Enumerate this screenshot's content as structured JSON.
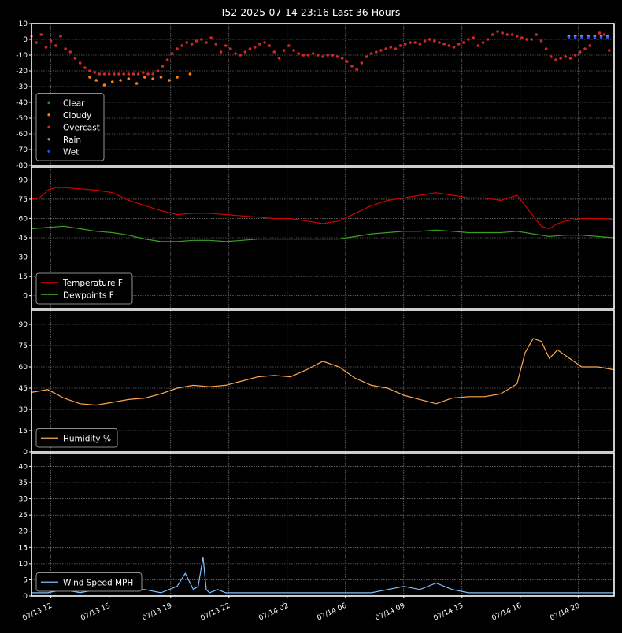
{
  "colors": {
    "background": "#000000",
    "frame": "#ffffff",
    "grid": "#9a9a9a",
    "clear": "#2ca02c",
    "cloudy": "#ff7f0e",
    "overcast": "#d62728",
    "rain": "#9a9a9a",
    "wet": "#1f4fff",
    "temperature": "#d40000",
    "dewpoint": "#3aa020",
    "humidity": "#ffa850",
    "wind": "#7fbfff"
  },
  "chart_data": [
    {
      "type": "scatter",
      "id": "sky",
      "title": "I52 2025-07-14 23:16 Last 36 Hours",
      "ylim": [
        -80,
        10
      ],
      "yticks": [
        10,
        0,
        -10,
        -20,
        -30,
        -40,
        -50,
        -60,
        -70,
        -80
      ],
      "grid": true,
      "legend_position": "lower-left",
      "legend": [
        "Clear",
        "Cloudy",
        "Overcast",
        "Rain",
        "Wet"
      ],
      "series": [
        {
          "name": "Overcast",
          "x": [
            0,
            0.3,
            0.6,
            0.9,
            1.2,
            1.5,
            1.8,
            2.1,
            2.4,
            2.7,
            3.0,
            3.3,
            3.6,
            3.9,
            4.2,
            4.5,
            4.8,
            5.1,
            5.4,
            5.7,
            6.0,
            6.3,
            6.6,
            6.9,
            7.2,
            7.5,
            7.8,
            8.1,
            8.4,
            8.7,
            9.0,
            9.3,
            9.6,
            9.9,
            10.2,
            10.5,
            10.8,
            11.1,
            11.4,
            11.7,
            12.0,
            12.3,
            12.6,
            12.9,
            13.2,
            13.5,
            13.8,
            14.1,
            14.4,
            14.7,
            15.0,
            15.3,
            15.6,
            15.9,
            16.2,
            16.5,
            16.8,
            17.1,
            17.4,
            17.7,
            18.0,
            18.3,
            18.6,
            18.9,
            19.2,
            19.5,
            19.8,
            20.1,
            20.4,
            20.7,
            21.0,
            21.3,
            21.6,
            21.9,
            22.2,
            22.5,
            22.8,
            23.1,
            23.4,
            23.7,
            24.0,
            24.3,
            24.6,
            24.9,
            25.2,
            25.5,
            25.8,
            26.1,
            26.4,
            26.7,
            27.0,
            27.3,
            27.6,
            27.9,
            28.2,
            28.5,
            28.8,
            29.1,
            29.4,
            29.7,
            30.0,
            30.3,
            30.6,
            30.9,
            31.2,
            31.5,
            31.8,
            32.1,
            32.4,
            32.7,
            33.0,
            33.3,
            33.6,
            33.9,
            34.2,
            34.5,
            34.8,
            35.1,
            35.4,
            35.7
          ],
          "y": [
            2,
            -2,
            3,
            -5,
            -1,
            -4,
            2,
            -6,
            -8,
            -12,
            -15,
            -18,
            -20,
            -21,
            -22,
            -22,
            -22,
            -22,
            -22,
            -22,
            -22,
            -22,
            -22,
            -21,
            -22,
            -22,
            -20,
            -17,
            -13,
            -9,
            -6,
            -4,
            -2,
            -3,
            -1,
            0,
            -2,
            1,
            -3,
            -8,
            -4,
            -6,
            -9,
            -10,
            -8,
            -6,
            -5,
            -3,
            -2,
            -4,
            -8,
            -12,
            -7,
            -4,
            -7,
            -9,
            -10,
            -10,
            -9,
            -10,
            -11,
            -10,
            -10,
            -11,
            -12,
            -14,
            -17,
            -19,
            -15,
            -11,
            -9,
            -8,
            -7,
            -6,
            -5,
            -6,
            -4,
            -3,
            -2,
            -2,
            -3,
            -1,
            0,
            -1,
            -2,
            -3,
            -4,
            -5,
            -3,
            -2,
            0,
            1,
            -4,
            -2,
            0,
            3,
            5,
            4,
            3,
            3,
            2,
            1,
            0,
            0,
            3,
            -1,
            -6,
            -11,
            -13,
            -12,
            -11,
            -12,
            -10,
            -8,
            -6,
            -4,
            1,
            4,
            3,
            -7
          ]
        },
        {
          "name": "Cloudy",
          "x": [
            3.6,
            4.0,
            4.5,
            5.0,
            5.5,
            6.0,
            6.5,
            7.0,
            7.5,
            8.0,
            8.5,
            9.0,
            9.8
          ],
          "y": [
            -24,
            -26,
            -29,
            -27,
            -26,
            -25,
            -28,
            -24,
            -25,
            -24,
            -26,
            -24,
            -22
          ]
        },
        {
          "name": "Rain",
          "x": [
            33.2,
            33.6,
            34.0,
            34.4,
            34.8,
            35.2,
            35.6
          ],
          "y": [
            2,
            2,
            2,
            2,
            2,
            2,
            2
          ]
        },
        {
          "name": "Wet",
          "x": [
            33.2,
            33.6,
            34.0,
            34.4,
            34.8,
            35.2,
            35.6
          ],
          "y": [
            1,
            1,
            1,
            1,
            1,
            1,
            1
          ]
        },
        {
          "name": "Clear",
          "x": [],
          "y": []
        }
      ]
    },
    {
      "type": "line",
      "id": "temps",
      "ylim": [
        -10,
        100
      ],
      "yticks": [
        90,
        75,
        60,
        45,
        30,
        15,
        0
      ],
      "grid": true,
      "legend_position": "lower-left",
      "series": [
        {
          "name": "Temperature F",
          "x": [
            0,
            0.5,
            1,
            1.5,
            2,
            3,
            4,
            5,
            6,
            7,
            8,
            9,
            10,
            11,
            12,
            13,
            14,
            15,
            16,
            17,
            18,
            19,
            20,
            21,
            22,
            23,
            24,
            25,
            26,
            27,
            28,
            29,
            30,
            31,
            31.5,
            32,
            32.5,
            33,
            33.5,
            34,
            34.5,
            35,
            35.5,
            36
          ],
          "y": [
            75,
            76,
            82,
            84,
            84,
            83,
            82,
            80,
            74,
            70,
            66,
            63,
            64,
            64,
            63,
            62,
            61,
            60,
            60,
            58,
            56,
            58,
            64,
            70,
            74,
            76,
            78,
            80,
            78,
            76,
            76,
            74,
            78,
            62,
            54,
            52,
            56,
            58,
            59,
            60,
            60,
            60,
            60,
            59
          ]
        },
        {
          "name": "Dewpoints F",
          "x": [
            0,
            1,
            2,
            3,
            4,
            5,
            6,
            7,
            8,
            9,
            10,
            11,
            12,
            13,
            14,
            15,
            16,
            17,
            18,
            19,
            20,
            21,
            22,
            23,
            24,
            25,
            26,
            27,
            28,
            29,
            30,
            31,
            32,
            33,
            34,
            35,
            36
          ],
          "y": [
            52,
            53,
            54,
            52,
            50,
            49,
            47,
            44,
            42,
            42,
            43,
            43,
            42,
            43,
            44,
            44,
            44,
            44,
            44,
            44,
            46,
            48,
            49,
            50,
            50,
            51,
            50,
            49,
            49,
            49,
            50,
            48,
            46,
            47,
            47,
            46,
            45
          ]
        }
      ]
    },
    {
      "type": "line",
      "id": "humidity",
      "ylim": [
        0,
        100
      ],
      "yticks": [
        90,
        75,
        60,
        45,
        30,
        15,
        0
      ],
      "grid": true,
      "legend_position": "lower-left",
      "series": [
        {
          "name": "Humidity %",
          "x": [
            0,
            1,
            2,
            3,
            4,
            5,
            6,
            7,
            8,
            9,
            10,
            11,
            12,
            13,
            14,
            15,
            16,
            17,
            18,
            19,
            20,
            21,
            22,
            23,
            24,
            25,
            26,
            27,
            28,
            29,
            30,
            30.5,
            31,
            31.5,
            32,
            32.5,
            33,
            34,
            35,
            36
          ],
          "y": [
            42,
            44,
            38,
            34,
            33,
            35,
            37,
            38,
            41,
            45,
            47,
            46,
            47,
            50,
            53,
            54,
            53,
            58,
            64,
            60,
            52,
            47,
            45,
            40,
            37,
            34,
            38,
            39,
            39,
            41,
            48,
            70,
            80,
            78,
            66,
            72,
            68,
            60,
            60,
            58
          ]
        }
      ]
    },
    {
      "type": "line",
      "id": "wind",
      "ylim": [
        0,
        44
      ],
      "yticks": [
        40,
        35,
        30,
        25,
        20,
        15,
        10,
        5,
        0
      ],
      "grid": true,
      "legend_position": "lower-left",
      "xticks": [
        "07/13 12",
        "07/13 15",
        "07/13 19",
        "07/13 22",
        "07/14 02",
        "07/14 06",
        "07/14 09",
        "07/14 13",
        "07/14 16",
        "07/14 20"
      ],
      "series": [
        {
          "name": "Wind Speed MPH",
          "x": [
            0,
            1,
            2,
            3,
            4,
            5,
            6,
            7,
            8,
            9,
            9.5,
            10,
            10.3,
            10.6,
            10.8,
            11,
            11.5,
            12,
            13,
            14,
            15,
            16,
            17,
            18,
            19,
            20,
            21,
            22,
            23,
            24,
            25,
            26,
            27,
            28,
            29,
            30,
            31,
            32,
            33,
            34,
            35,
            36
          ],
          "y": [
            1,
            1,
            2,
            1,
            2,
            2,
            2,
            2,
            1,
            3,
            7,
            2,
            3,
            12,
            2,
            1,
            2,
            1,
            1,
            1,
            1,
            1,
            1,
            1,
            1,
            1,
            1,
            2,
            3,
            2,
            4,
            2,
            1,
            1,
            1,
            1,
            1,
            1,
            1,
            1,
            1,
            1
          ]
        }
      ]
    }
  ]
}
